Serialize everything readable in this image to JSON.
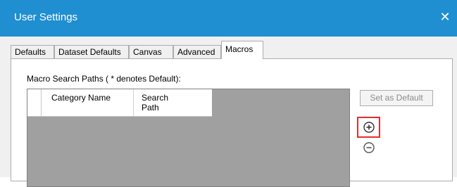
{
  "window": {
    "title": "User Settings",
    "close_glyph": "✕"
  },
  "tabs": [
    {
      "label": "Defaults",
      "selected": false
    },
    {
      "label": "Dataset Defaults",
      "selected": false
    },
    {
      "label": "Canvas",
      "selected": false
    },
    {
      "label": "Advanced",
      "selected": false
    },
    {
      "label": "Macros",
      "selected": true
    }
  ],
  "macros": {
    "section_label": "Macro Search Paths ( * denotes Default):",
    "columns": [
      "Category Name",
      "Search Path"
    ],
    "rows": [],
    "set_default_label": "Set as Default",
    "add_icon": "plus-circle-icon",
    "remove_icon": "minus-circle-icon"
  },
  "colors": {
    "titlebar": "#1f8fd2",
    "grid_background": "#a0a0a0",
    "highlight": "#e0312c"
  }
}
